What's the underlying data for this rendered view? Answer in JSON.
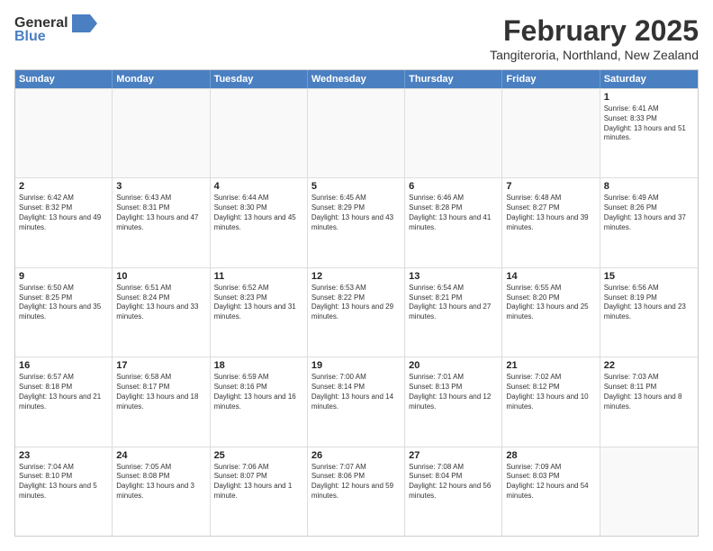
{
  "header": {
    "logo_general": "General",
    "logo_blue": "Blue",
    "title": "February 2025",
    "subtitle": "Tangiteroria, Northland, New Zealand"
  },
  "days_of_week": [
    "Sunday",
    "Monday",
    "Tuesday",
    "Wednesday",
    "Thursday",
    "Friday",
    "Saturday"
  ],
  "weeks": [
    [
      {
        "day": "",
        "info": ""
      },
      {
        "day": "",
        "info": ""
      },
      {
        "day": "",
        "info": ""
      },
      {
        "day": "",
        "info": ""
      },
      {
        "day": "",
        "info": ""
      },
      {
        "day": "",
        "info": ""
      },
      {
        "day": "1",
        "sunrise": "6:41 AM",
        "sunset": "8:33 PM",
        "daylight": "13 hours and 51 minutes."
      }
    ],
    [
      {
        "day": "2",
        "sunrise": "6:42 AM",
        "sunset": "8:32 PM",
        "daylight": "13 hours and 49 minutes."
      },
      {
        "day": "3",
        "sunrise": "6:43 AM",
        "sunset": "8:31 PM",
        "daylight": "13 hours and 47 minutes."
      },
      {
        "day": "4",
        "sunrise": "6:44 AM",
        "sunset": "8:30 PM",
        "daylight": "13 hours and 45 minutes."
      },
      {
        "day": "5",
        "sunrise": "6:45 AM",
        "sunset": "8:29 PM",
        "daylight": "13 hours and 43 minutes."
      },
      {
        "day": "6",
        "sunrise": "6:46 AM",
        "sunset": "8:28 PM",
        "daylight": "13 hours and 41 minutes."
      },
      {
        "day": "7",
        "sunrise": "6:48 AM",
        "sunset": "8:27 PM",
        "daylight": "13 hours and 39 minutes."
      },
      {
        "day": "8",
        "sunrise": "6:49 AM",
        "sunset": "8:26 PM",
        "daylight": "13 hours and 37 minutes."
      }
    ],
    [
      {
        "day": "9",
        "sunrise": "6:50 AM",
        "sunset": "8:25 PM",
        "daylight": "13 hours and 35 minutes."
      },
      {
        "day": "10",
        "sunrise": "6:51 AM",
        "sunset": "8:24 PM",
        "daylight": "13 hours and 33 minutes."
      },
      {
        "day": "11",
        "sunrise": "6:52 AM",
        "sunset": "8:23 PM",
        "daylight": "13 hours and 31 minutes."
      },
      {
        "day": "12",
        "sunrise": "6:53 AM",
        "sunset": "8:22 PM",
        "daylight": "13 hours and 29 minutes."
      },
      {
        "day": "13",
        "sunrise": "6:54 AM",
        "sunset": "8:21 PM",
        "daylight": "13 hours and 27 minutes."
      },
      {
        "day": "14",
        "sunrise": "6:55 AM",
        "sunset": "8:20 PM",
        "daylight": "13 hours and 25 minutes."
      },
      {
        "day": "15",
        "sunrise": "6:56 AM",
        "sunset": "8:19 PM",
        "daylight": "13 hours and 23 minutes."
      }
    ],
    [
      {
        "day": "16",
        "sunrise": "6:57 AM",
        "sunset": "8:18 PM",
        "daylight": "13 hours and 21 minutes."
      },
      {
        "day": "17",
        "sunrise": "6:58 AM",
        "sunset": "8:17 PM",
        "daylight": "13 hours and 18 minutes."
      },
      {
        "day": "18",
        "sunrise": "6:59 AM",
        "sunset": "8:16 PM",
        "daylight": "13 hours and 16 minutes."
      },
      {
        "day": "19",
        "sunrise": "7:00 AM",
        "sunset": "8:14 PM",
        "daylight": "13 hours and 14 minutes."
      },
      {
        "day": "20",
        "sunrise": "7:01 AM",
        "sunset": "8:13 PM",
        "daylight": "13 hours and 12 minutes."
      },
      {
        "day": "21",
        "sunrise": "7:02 AM",
        "sunset": "8:12 PM",
        "daylight": "13 hours and 10 minutes."
      },
      {
        "day": "22",
        "sunrise": "7:03 AM",
        "sunset": "8:11 PM",
        "daylight": "13 hours and 8 minutes."
      }
    ],
    [
      {
        "day": "23",
        "sunrise": "7:04 AM",
        "sunset": "8:10 PM",
        "daylight": "13 hours and 5 minutes."
      },
      {
        "day": "24",
        "sunrise": "7:05 AM",
        "sunset": "8:08 PM",
        "daylight": "13 hours and 3 minutes."
      },
      {
        "day": "25",
        "sunrise": "7:06 AM",
        "sunset": "8:07 PM",
        "daylight": "13 hours and 1 minute."
      },
      {
        "day": "26",
        "sunrise": "7:07 AM",
        "sunset": "8:06 PM",
        "daylight": "12 hours and 59 minutes."
      },
      {
        "day": "27",
        "sunrise": "7:08 AM",
        "sunset": "8:04 PM",
        "daylight": "12 hours and 56 minutes."
      },
      {
        "day": "28",
        "sunrise": "7:09 AM",
        "sunset": "8:03 PM",
        "daylight": "12 hours and 54 minutes."
      },
      {
        "day": "",
        "info": ""
      }
    ]
  ]
}
